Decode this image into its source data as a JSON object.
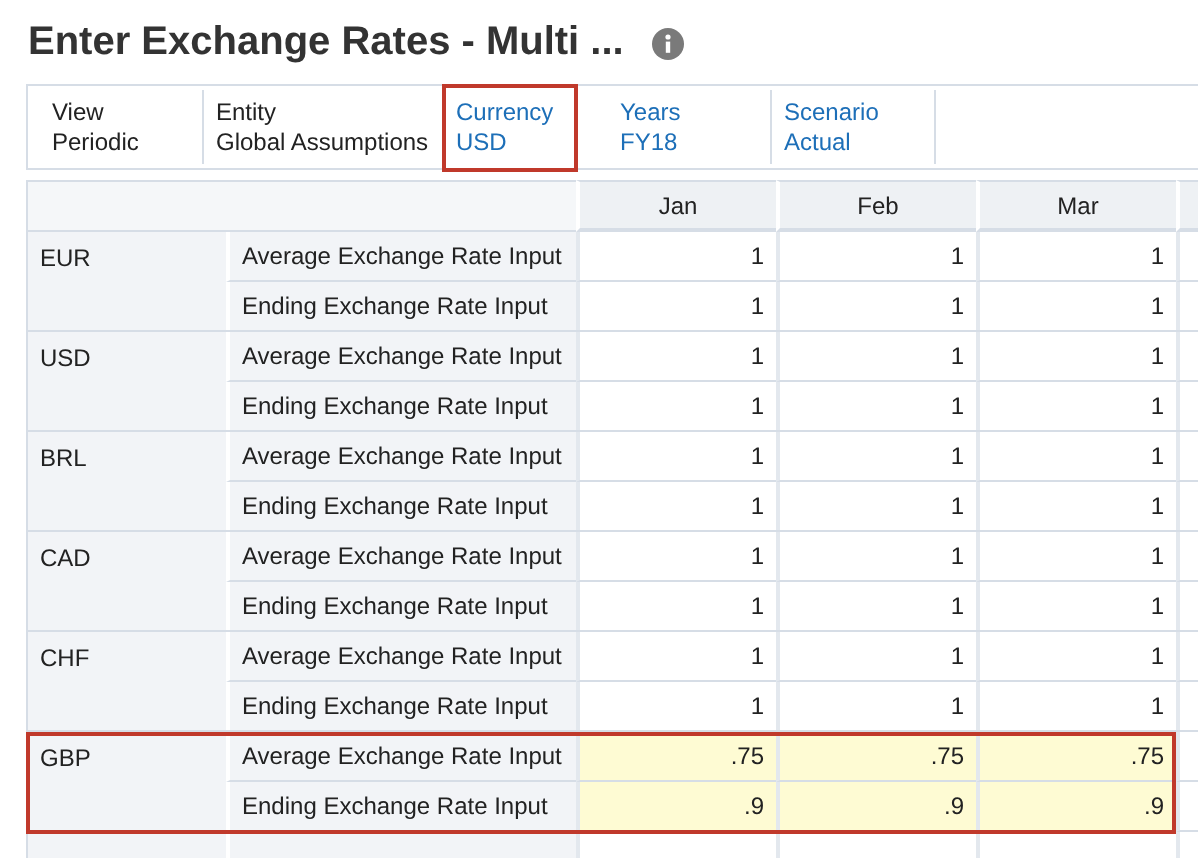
{
  "title": "Enter Exchange Rates - Multi ...",
  "pov": [
    {
      "label": "View",
      "value": "Periodic",
      "selectable": false,
      "highlighted": false
    },
    {
      "label": "Entity",
      "value": "Global Assumptions",
      "selectable": false,
      "highlighted": false
    },
    {
      "label": "Currency",
      "value": "USD",
      "selectable": true,
      "highlighted": true
    },
    {
      "label": "Years",
      "value": "FY18",
      "selectable": true,
      "highlighted": false
    },
    {
      "label": "Scenario",
      "value": "Actual",
      "selectable": true,
      "highlighted": false
    }
  ],
  "columns": [
    "Jan",
    "Feb",
    "Mar"
  ],
  "groups": [
    {
      "currency": "EUR",
      "highlighted": false,
      "rows": [
        {
          "account": "Average Exchange Rate Input",
          "cells": [
            {
              "value": "1",
              "changed": false
            },
            {
              "value": "1",
              "changed": false
            },
            {
              "value": "1",
              "changed": false
            }
          ]
        },
        {
          "account": "Ending Exchange Rate Input",
          "cells": [
            {
              "value": "1",
              "changed": false
            },
            {
              "value": "1",
              "changed": false
            },
            {
              "value": "1",
              "changed": false
            }
          ]
        }
      ]
    },
    {
      "currency": "USD",
      "highlighted": false,
      "rows": [
        {
          "account": "Average Exchange Rate Input",
          "cells": [
            {
              "value": "1",
              "changed": false
            },
            {
              "value": "1",
              "changed": false
            },
            {
              "value": "1",
              "changed": false
            }
          ]
        },
        {
          "account": "Ending Exchange Rate Input",
          "cells": [
            {
              "value": "1",
              "changed": false
            },
            {
              "value": "1",
              "changed": false
            },
            {
              "value": "1",
              "changed": false
            }
          ]
        }
      ]
    },
    {
      "currency": "BRL",
      "highlighted": false,
      "rows": [
        {
          "account": "Average Exchange Rate Input",
          "cells": [
            {
              "value": "1",
              "changed": false
            },
            {
              "value": "1",
              "changed": false
            },
            {
              "value": "1",
              "changed": false
            }
          ]
        },
        {
          "account": "Ending Exchange Rate Input",
          "cells": [
            {
              "value": "1",
              "changed": false
            },
            {
              "value": "1",
              "changed": false
            },
            {
              "value": "1",
              "changed": false
            }
          ]
        }
      ]
    },
    {
      "currency": "CAD",
      "highlighted": false,
      "rows": [
        {
          "account": "Average Exchange Rate Input",
          "cells": [
            {
              "value": "1",
              "changed": false
            },
            {
              "value": "1",
              "changed": false
            },
            {
              "value": "1",
              "changed": false
            }
          ]
        },
        {
          "account": "Ending Exchange Rate Input",
          "cells": [
            {
              "value": "1",
              "changed": false
            },
            {
              "value": "1",
              "changed": false
            },
            {
              "value": "1",
              "changed": false
            }
          ]
        }
      ]
    },
    {
      "currency": "CHF",
      "highlighted": false,
      "rows": [
        {
          "account": "Average Exchange Rate Input",
          "cells": [
            {
              "value": "1",
              "changed": false
            },
            {
              "value": "1",
              "changed": false
            },
            {
              "value": "1",
              "changed": false
            }
          ]
        },
        {
          "account": "Ending Exchange Rate Input",
          "cells": [
            {
              "value": "1",
              "changed": false
            },
            {
              "value": "1",
              "changed": false
            },
            {
              "value": "1",
              "changed": false
            }
          ]
        }
      ]
    },
    {
      "currency": "GBP",
      "highlighted": true,
      "rows": [
        {
          "account": "Average Exchange Rate Input",
          "cells": [
            {
              "value": ".75",
              "changed": true
            },
            {
              "value": ".75",
              "changed": true
            },
            {
              "value": ".75",
              "changed": true
            }
          ]
        },
        {
          "account": "Ending Exchange Rate Input",
          "cells": [
            {
              "value": ".9",
              "changed": true
            },
            {
              "value": ".9",
              "changed": true
            },
            {
              "value": ".9",
              "changed": true
            }
          ]
        }
      ]
    }
  ]
}
